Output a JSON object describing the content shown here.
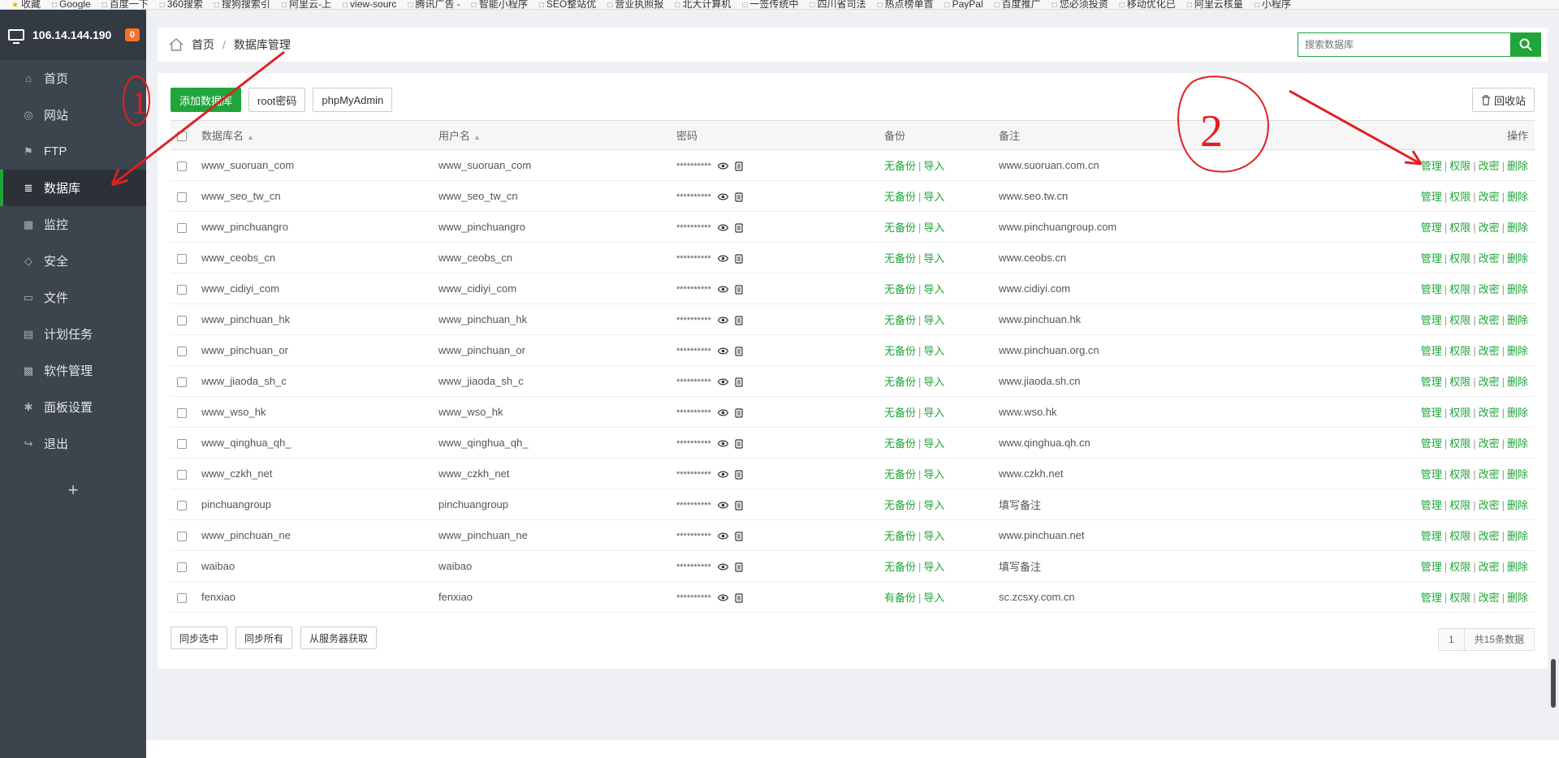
{
  "bookmarks": [
    "收藏",
    "Google",
    "百度一下",
    "360搜索",
    "搜狗搜索引",
    "阿里云-上",
    "view-sourc",
    "腾讯广告 -",
    "智能小程序",
    "SEO整站优",
    "营业执照报",
    "北大计算机",
    "一签传统中",
    "四川省司法",
    "热点榜单首",
    "PayPal",
    "百度推广",
    "您必须投资",
    "移动优化已",
    "阿里云核量",
    "小程序"
  ],
  "server": {
    "ip": "106.14.144.190",
    "badge": "0"
  },
  "nav": [
    {
      "label": "首页",
      "icon": "home-icon"
    },
    {
      "label": "网站",
      "icon": "globe-icon"
    },
    {
      "label": "FTP",
      "icon": "ftp-icon"
    },
    {
      "label": "数据库",
      "icon": "database-icon"
    },
    {
      "label": "监控",
      "icon": "monitor-icon"
    },
    {
      "label": "安全",
      "icon": "shield-icon"
    },
    {
      "label": "文件",
      "icon": "folder-icon"
    },
    {
      "label": "计划任务",
      "icon": "calendar-icon"
    },
    {
      "label": "软件管理",
      "icon": "apps-icon"
    },
    {
      "label": "面板设置",
      "icon": "gear-icon"
    },
    {
      "label": "退出",
      "icon": "logout-icon"
    }
  ],
  "add_symbol": "+",
  "breadcrumb": {
    "home": "首页",
    "separator": "/",
    "current": "数据库管理"
  },
  "search": {
    "placeholder": "搜索数据库"
  },
  "toolbar": {
    "add": "添加数据库",
    "root": "root密码",
    "pma": "phpMyAdmin",
    "recycle": "回收站"
  },
  "table": {
    "headers": {
      "name": "数据库名",
      "user": "用户名",
      "password": "密码",
      "backup": "备份",
      "note": "备注",
      "ops": "操作"
    },
    "password_mask": "**********",
    "import_label": "导入",
    "ops": [
      "管理",
      "权限",
      "改密",
      "删除"
    ],
    "rows": [
      {
        "name": "www_suoruan_com",
        "user": "www_suoruan_com",
        "backup": "无备份",
        "note": "www.suoruan.com.cn"
      },
      {
        "name": "www_seo_tw_cn",
        "user": "www_seo_tw_cn",
        "backup": "无备份",
        "note": "www.seo.tw.cn"
      },
      {
        "name": "www_pinchuangro",
        "user": "www_pinchuangro",
        "backup": "无备份",
        "note": "www.pinchuangroup.com"
      },
      {
        "name": "www_ceobs_cn",
        "user": "www_ceobs_cn",
        "backup": "无备份",
        "note": "www.ceobs.cn"
      },
      {
        "name": "www_cidiyi_com",
        "user": "www_cidiyi_com",
        "backup": "无备份",
        "note": "www.cidiyi.com"
      },
      {
        "name": "www_pinchuan_hk",
        "user": "www_pinchuan_hk",
        "backup": "无备份",
        "note": "www.pinchuan.hk"
      },
      {
        "name": "www_pinchuan_or",
        "user": "www_pinchuan_or",
        "backup": "无备份",
        "note": "www.pinchuan.org.cn"
      },
      {
        "name": "www_jiaoda_sh_c",
        "user": "www_jiaoda_sh_c",
        "backup": "无备份",
        "note": "www.jiaoda.sh.cn"
      },
      {
        "name": "www_wso_hk",
        "user": "www_wso_hk",
        "backup": "无备份",
        "note": "www.wso.hk"
      },
      {
        "name": "www_qinghua_qh_",
        "user": "www_qinghua_qh_",
        "backup": "无备份",
        "note": "www.qinghua.qh.cn"
      },
      {
        "name": "www_czkh_net",
        "user": "www_czkh_net",
        "backup": "无备份",
        "note": "www.czkh.net"
      },
      {
        "name": "pinchuangroup",
        "user": "pinchuangroup",
        "backup": "无备份",
        "note": "填写备注"
      },
      {
        "name": "www_pinchuan_ne",
        "user": "www_pinchuan_ne",
        "backup": "无备份",
        "note": "www.pinchuan.net"
      },
      {
        "name": "waibao",
        "user": "waibao",
        "backup": "无备份",
        "note": "填写备注"
      },
      {
        "name": "fenxiao",
        "user": "fenxiao",
        "backup": "有备份",
        "note": "sc.zcsxy.com.cn"
      }
    ]
  },
  "bottom": {
    "sync_selected": "同步选中",
    "sync_all": "同步所有",
    "fetch": "从服务器获取"
  },
  "pager": {
    "page": "1",
    "total": "共15条数据"
  },
  "annotations": {
    "mark1": "1",
    "mark2": "2"
  },
  "colors": {
    "accent": "#20a53a",
    "sidebar": "#3c444d",
    "badge": "#f7702a",
    "annotation": "#e02020"
  }
}
